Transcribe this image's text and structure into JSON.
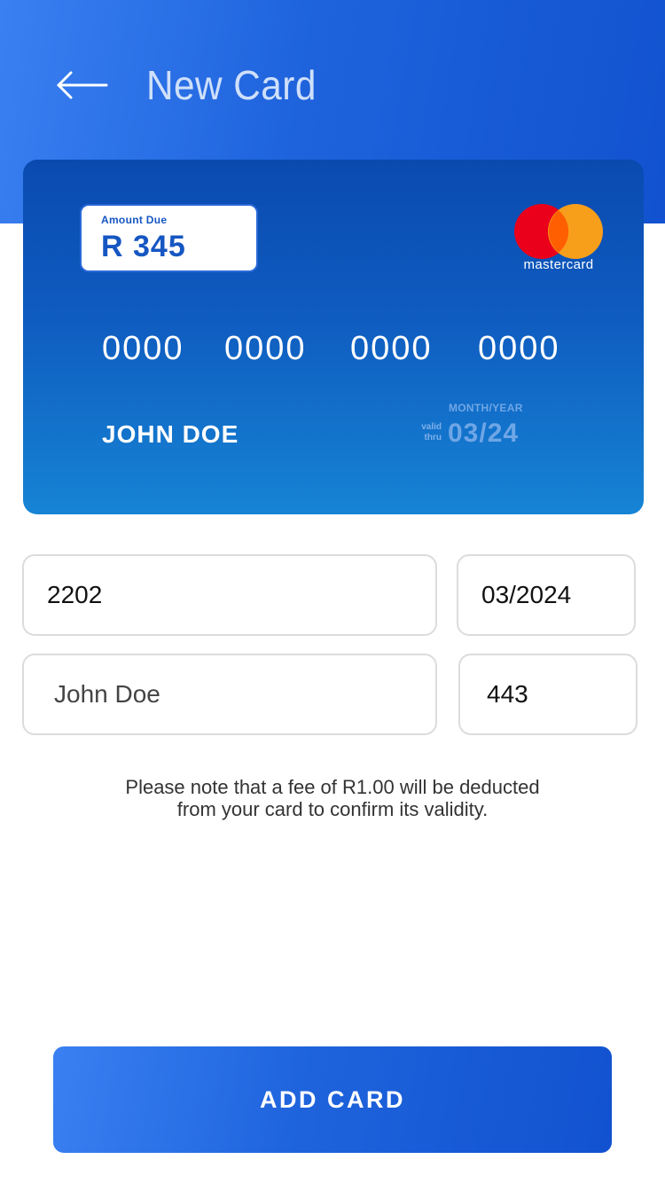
{
  "header": {
    "back_icon": "arrow-left-icon",
    "title": "New Card"
  },
  "card": {
    "amount_label": "Amount Due",
    "amount_value": "R 345",
    "brand": "mastercard",
    "brand_icon": "mastercard-logo-icon",
    "number_groups": [
      "0000",
      "0000",
      "0000",
      "0000"
    ],
    "holder_name": "JOHN DOE",
    "valid_thru_line1": "valid",
    "valid_thru_line2": "thru",
    "month_year_label": "MONTH/YEAR",
    "expiry": "03/24"
  },
  "form": {
    "card_number_value": "2202",
    "expiry_value": "03/2024",
    "name_placeholder": "John Doe",
    "cvv_value": "443"
  },
  "fee_note": {
    "line1": "Please note that a fee of R1.00 will be deducted",
    "line2": "from your card to confirm its validity."
  },
  "actions": {
    "add_card_label": "ADD CARD"
  },
  "colors": {
    "primary": "#1e63dc",
    "card_top": "#0a4ab0",
    "card_bottom": "#1684d4",
    "mastercard_red": "#eb001b",
    "mastercard_orange": "#f79e1b",
    "mastercard_overlap": "#ff5f00"
  }
}
